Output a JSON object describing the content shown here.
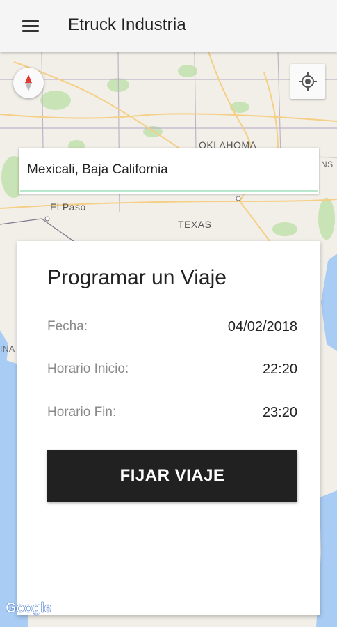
{
  "appbar": {
    "title": "Etruck Industria",
    "menu_icon": "hamburger-menu-icon"
  },
  "map": {
    "labels": {
      "oklahoma": "OKLAHOMA",
      "el_paso": "El Paso",
      "texas": "TEXAS",
      "edge_left": "INA",
      "edge_right": "NS"
    },
    "compass_icon": "compass-icon",
    "locate_icon": "my-location-icon",
    "logo": "Google"
  },
  "search": {
    "value": "Mexicali, Baja California"
  },
  "card": {
    "title": "Programar un Viaje",
    "fecha_label": "Fecha:",
    "fecha_value": "04/02/2018",
    "inicio_label": "Horario Inicio:",
    "inicio_value": "22:20",
    "fin_label": "Horario Fin:",
    "fin_value": "23:20",
    "button_label": "FIJAR VIAJE"
  },
  "colors": {
    "accent_underline": "#b8e8cc",
    "button_bg": "#212121",
    "water": "#a9ccf4",
    "land": "#f2efe9",
    "park": "#c8e3b5"
  }
}
